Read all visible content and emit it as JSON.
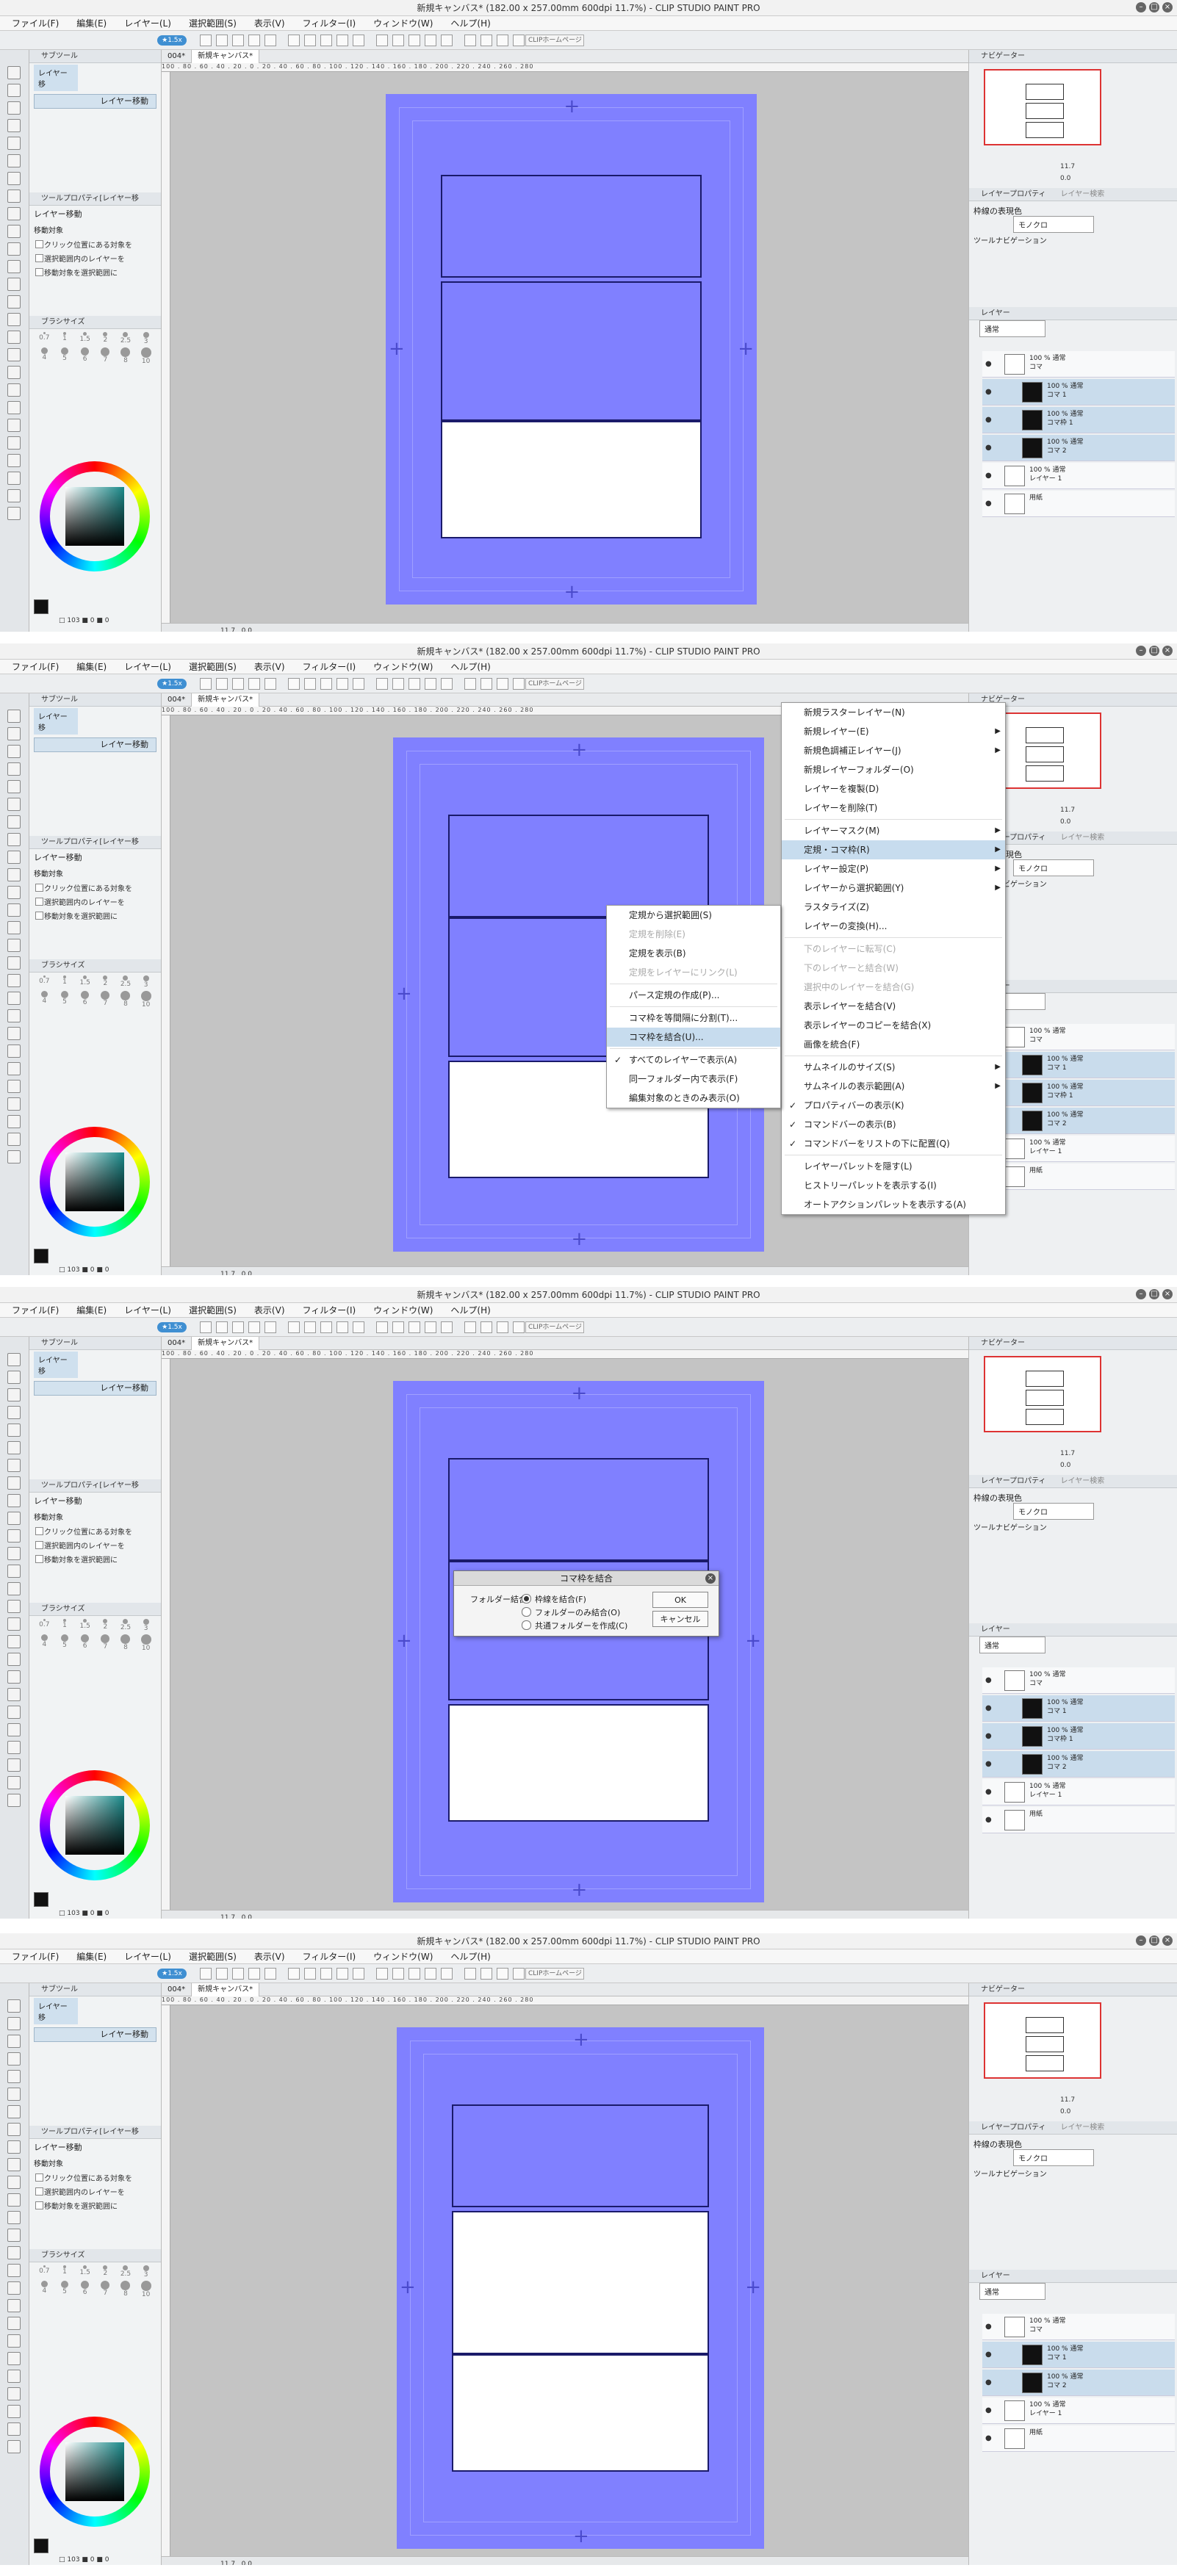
{
  "app": {
    "title": "新規キャンバス* (182.00 x 257.00mm 600dpi 11.7%) - CLIP STUDIO PAINT PRO",
    "menu": [
      "ファイル(F)",
      "編集(E)",
      "レイヤー(L)",
      "選択範囲(S)",
      "表示(V)",
      "フィルター(I)",
      "ウィンドウ(W)",
      "ヘルプ(H)"
    ],
    "badge": "★1.5x",
    "csp_home": "CLIPホームページ",
    "doc_id": "004*",
    "tab": "新規キャンバス*",
    "ruler": "100 . 80 . 60 . 40 . 20 . 0 . 20 . 40 . 60 . 80 . 100 . 120 . 140 . 160 . 180 . 200 . 220 . 240 . 260 . 280"
  },
  "left": {
    "subtool_title": "サブツール",
    "subtool_tab": "レイヤー移",
    "subtool_item": "レイヤー移動",
    "toolprop_title": "ツールプロパティ[レイヤー移",
    "toolprop_name": "レイヤー移動",
    "move_target": "移動対象",
    "opts": [
      "クリック位置にある対象を",
      "選択範囲内のレイヤーを",
      "移動対象を選択範囲に"
    ],
    "brush_title": "ブラシサイズ",
    "brush_sizes": [
      "0.7",
      "1",
      "1.5",
      "2",
      "2.5",
      "3",
      "4",
      "5",
      "6",
      "7",
      "8",
      "10"
    ],
    "color_foot": "□ 103 ■ 0 ■ 0"
  },
  "status": {
    "zoom": "11.7",
    "angle": "0.0"
  },
  "right": {
    "nav_title": "ナビゲーター",
    "nav_zoom": "11.7",
    "nav_angle": "0.0",
    "lp_title": "レイヤープロパティ",
    "lp_tab2": "レイヤー検索",
    "border_color": "枠線の表現色",
    "mono": "モノクロ",
    "tool_nav": "ツールナビゲーション",
    "layer_title": "レイヤー",
    "blend": "通常"
  },
  "shots": [
    {
      "layers": [
        {
          "n": "100 % 通常",
          "l": "コマ",
          "type": "folder"
        },
        {
          "n": "100 % 通常",
          "l": "コマ 1",
          "type": "koma"
        },
        {
          "n": "100 % 通常",
          "l": "コマ枠 1",
          "type": "koma"
        },
        {
          "n": "100 % 通常",
          "l": "コマ 2",
          "type": "koma"
        },
        {
          "n": "100 % 通常",
          "l": "レイヤー 1",
          "type": "raster"
        },
        {
          "n": "",
          "l": "用紙",
          "type": "paper"
        }
      ]
    },
    {
      "layers": [
        {
          "n": "100 % 通常",
          "l": "コマ",
          "type": "folder"
        },
        {
          "n": "100 % 通常",
          "l": "コマ 1",
          "type": "koma"
        },
        {
          "n": "100 % 通常",
          "l": "コマ枠 1",
          "type": "koma"
        },
        {
          "n": "100 % 通常",
          "l": "コマ 2",
          "type": "koma"
        },
        {
          "n": "100 % 通常",
          "l": "レイヤー 1",
          "type": "raster"
        },
        {
          "n": "",
          "l": "用紙",
          "type": "paper"
        }
      ],
      "main_menu": [
        {
          "t": "新規ラスターレイヤー(N)"
        },
        {
          "t": "新規レイヤー(E)",
          "arrow": true
        },
        {
          "t": "新規色調補正レイヤー(J)",
          "arrow": true
        },
        {
          "t": "新規レイヤーフォルダー(O)"
        },
        {
          "t": "レイヤーを複製(D)"
        },
        {
          "t": "レイヤーを削除(T)"
        },
        {
          "sep": true
        },
        {
          "t": "レイヤーマスク(M)",
          "arrow": true
        },
        {
          "t": "定規・コマ枠(R)",
          "arrow": true,
          "hl": true
        },
        {
          "t": "レイヤー設定(P)",
          "arrow": true
        },
        {
          "t": "レイヤーから選択範囲(Y)",
          "arrow": true
        },
        {
          "t": "ラスタライズ(Z)"
        },
        {
          "t": "レイヤーの変換(H)..."
        },
        {
          "sep": true
        },
        {
          "t": "下のレイヤーに転写(C)",
          "dis": true
        },
        {
          "t": "下のレイヤーと結合(W)",
          "dis": true
        },
        {
          "t": "選択中のレイヤーを結合(G)",
          "dis": true
        },
        {
          "t": "表示レイヤーを結合(V)"
        },
        {
          "t": "表示レイヤーのコピーを結合(X)"
        },
        {
          "t": "画像を統合(F)"
        },
        {
          "sep": true
        },
        {
          "t": "サムネイルのサイズ(S)",
          "arrow": true
        },
        {
          "t": "サムネイルの表示範囲(A)",
          "arrow": true
        },
        {
          "t": "プロパティバーの表示(K)",
          "chk": true
        },
        {
          "t": "コマンドバーの表示(B)",
          "chk": true
        },
        {
          "t": "コマンドバーをリストの下に配置(Q)",
          "chk": true
        },
        {
          "sep": true
        },
        {
          "t": "レイヤーパレットを隠す(L)"
        },
        {
          "t": "ヒストリーパレットを表示する(I)"
        },
        {
          "t": "オートアクションパレットを表示する(A)"
        }
      ],
      "sub_menu": [
        {
          "t": "定規から選択範囲(S)"
        },
        {
          "t": "定規を削除(E)",
          "dis": true
        },
        {
          "t": "定規を表示(B)"
        },
        {
          "t": "定規をレイヤーにリンク(L)",
          "dis": true
        },
        {
          "sep": true
        },
        {
          "t": "パース定規の作成(P)..."
        },
        {
          "sep": true
        },
        {
          "t": "コマ枠を等間隔に分割(T)..."
        },
        {
          "t": "コマ枠を結合(U)...",
          "hl": true
        },
        {
          "sep": true
        },
        {
          "t": "すべてのレイヤーで表示(A)",
          "chk": true
        },
        {
          "t": "同一フォルダー内で表示(F)"
        },
        {
          "t": "編集対象のときのみ表示(O)"
        }
      ]
    },
    {
      "layers": [
        {
          "n": "100 % 通常",
          "l": "コマ",
          "type": "folder"
        },
        {
          "n": "100 % 通常",
          "l": "コマ 1",
          "type": "koma"
        },
        {
          "n": "100 % 通常",
          "l": "コマ枠 1",
          "type": "koma"
        },
        {
          "n": "100 % 通常",
          "l": "コマ 2",
          "type": "koma"
        },
        {
          "n": "100 % 通常",
          "l": "レイヤー 1",
          "type": "raster"
        },
        {
          "n": "",
          "l": "用紙",
          "type": "paper"
        }
      ],
      "dialog": {
        "title": "コマ枠を結合",
        "label": "フォルダー結合:",
        "opt1": "枠線を結合(F)",
        "opt2": "フォルダーのみ結合(O)",
        "opt3": "共通フォルダーを作成(C)",
        "ok": "OK",
        "cancel": "キャンセル"
      }
    },
    {
      "layers": [
        {
          "n": "100 % 通常",
          "l": "コマ",
          "type": "folder"
        },
        {
          "n": "100 % 通常",
          "l": "コマ 1",
          "type": "koma"
        },
        {
          "n": "100 % 通常",
          "l": "コマ 2",
          "type": "koma"
        },
        {
          "n": "100 % 通常",
          "l": "レイヤー 1",
          "type": "raster"
        },
        {
          "n": "",
          "l": "用紙",
          "type": "paper"
        }
      ]
    }
  ]
}
